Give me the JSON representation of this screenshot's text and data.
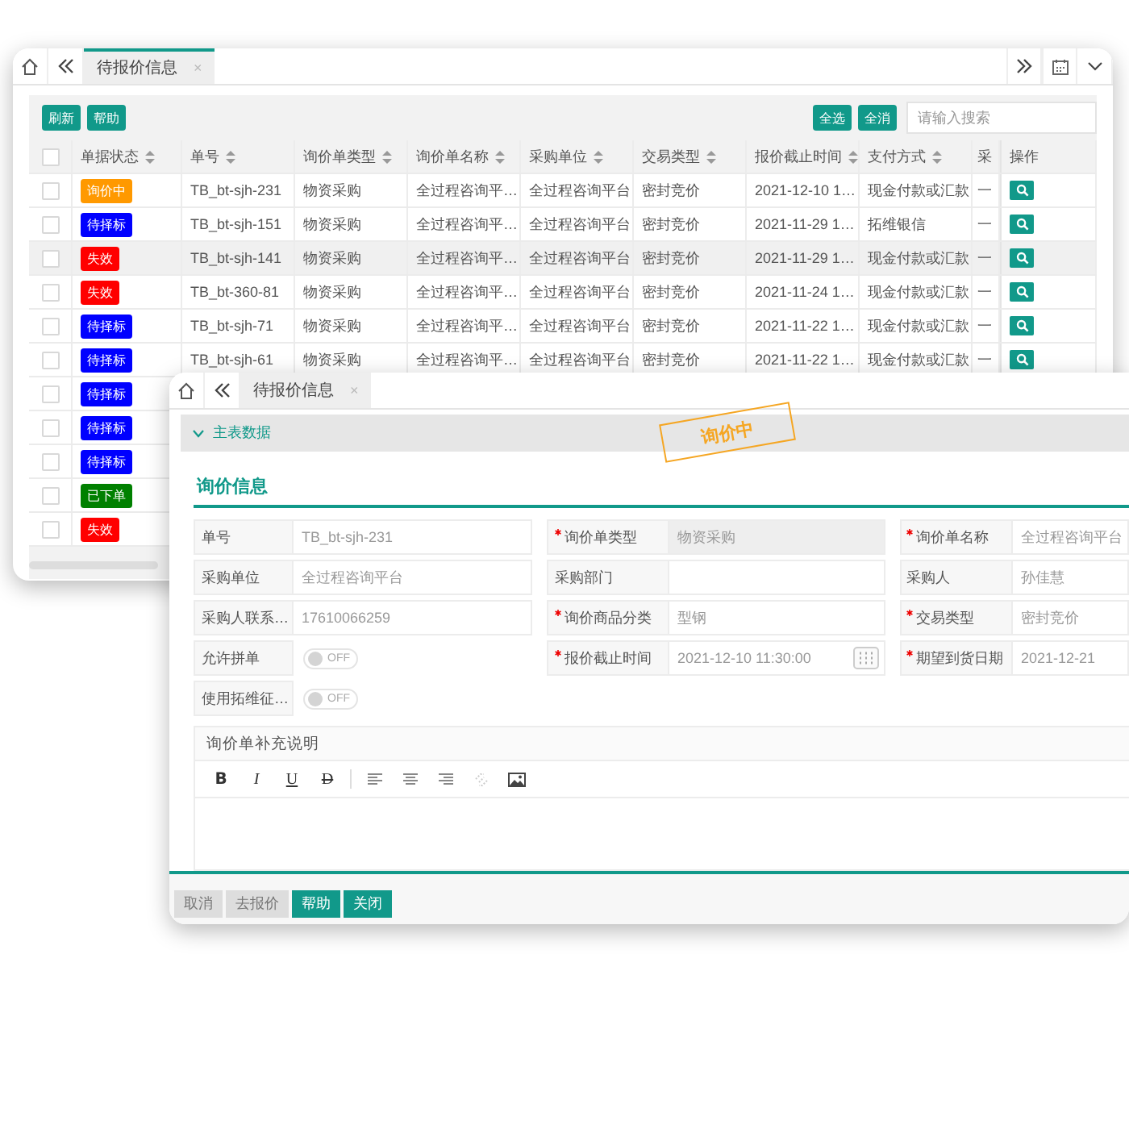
{
  "back_window": {
    "tab": {
      "label": "待报价信息",
      "close": "×",
      "selected": true
    },
    "toolbar": {
      "left_buttons": [
        "刷新",
        "帮助"
      ],
      "right_buttons": [
        "全选",
        "全消"
      ],
      "search": {
        "placeholder": "请输入搜索"
      }
    },
    "table": {
      "header_checked": false,
      "columns": [
        "单据状态",
        "单号",
        "询价单类型",
        "询价单名称",
        "采购单位",
        "交易类型",
        "报价截止时间",
        "支付方式",
        "采",
        "操作"
      ],
      "rows": [
        {
          "checked": false,
          "selected": false,
          "status": {
            "text": "询价中",
            "color": "#ff9900"
          },
          "cells": [
            "TB_bt-sjh-231",
            "物资采购",
            "全过程咨询平…",
            "全过程咨询平台",
            "密封竞价",
            "2021-12-10 1…",
            "现金付款或汇款",
            "一"
          ]
        },
        {
          "checked": false,
          "selected": false,
          "status": {
            "text": "待择标",
            "color": "#0000ff"
          },
          "cells": [
            "TB_bt-sjh-151",
            "物资采购",
            "全过程咨询平…",
            "全过程咨询平台",
            "密封竞价",
            "2021-11-29 1…",
            "拓维银信",
            "一"
          ]
        },
        {
          "checked": false,
          "selected": true,
          "status": {
            "text": "失效",
            "color": "#ff0000"
          },
          "cells": [
            "TB_bt-sjh-141",
            "物资采购",
            "全过程咨询平…",
            "全过程咨询平台",
            "密封竞价",
            "2021-11-29 1…",
            "现金付款或汇款",
            "一"
          ]
        },
        {
          "checked": false,
          "selected": false,
          "status": {
            "text": "失效",
            "color": "#ff0000"
          },
          "cells": [
            "TB_bt-360-81",
            "物资采购",
            "全过程咨询平…",
            "全过程咨询平台",
            "密封竞价",
            "2021-11-24 1…",
            "现金付款或汇款",
            "一"
          ]
        },
        {
          "checked": false,
          "selected": false,
          "status": {
            "text": "待择标",
            "color": "#0000ff"
          },
          "cells": [
            "TB_bt-sjh-71",
            "物资采购",
            "全过程咨询平…",
            "全过程咨询平台",
            "密封竞价",
            "2021-11-22 1…",
            "现金付款或汇款",
            "一"
          ]
        },
        {
          "checked": false,
          "selected": false,
          "status": {
            "text": "待择标",
            "color": "#0000ff"
          },
          "cells": [
            "TB_bt-sjh-61",
            "物资采购",
            "全过程咨询平…",
            "全过程咨询平台",
            "密封竞价",
            "2021-11-22 1…",
            "现金付款或汇款",
            "一"
          ]
        },
        {
          "checked": false,
          "selected": false,
          "status": {
            "text": "待择标",
            "color": "#0000ff"
          }
        },
        {
          "checked": false,
          "selected": false,
          "status": {
            "text": "待择标",
            "color": "#0000ff"
          }
        },
        {
          "checked": false,
          "selected": false,
          "status": {
            "text": "待择标",
            "color": "#0000ff"
          }
        },
        {
          "checked": false,
          "selected": false,
          "status": {
            "text": "已下单",
            "color": "#008000"
          }
        },
        {
          "checked": false,
          "selected": false,
          "status": {
            "text": "失效",
            "color": "#ff0000"
          }
        }
      ]
    }
  },
  "front_window": {
    "tab": {
      "label": "待报价信息",
      "close": "×",
      "selected": true
    },
    "section": {
      "label": "主表数据",
      "expanded": true
    },
    "stamp": "询价中",
    "title": "询价信息",
    "fields": [
      {
        "kind": "text",
        "label": "单号",
        "value": "TB_bt-sjh-231",
        "required": false,
        "disabled": false
      },
      {
        "kind": "text",
        "label": "询价单类型",
        "value": "物资采购",
        "required": true,
        "disabled": true
      },
      {
        "kind": "text",
        "label": "询价单名称",
        "value": "全过程咨询平台",
        "required": true,
        "disabled": false
      },
      {
        "kind": "text",
        "label": "采购单位",
        "value": "全过程咨询平台",
        "required": false,
        "disabled": false
      },
      {
        "kind": "text",
        "label": "采购部门",
        "required": false,
        "disabled": false
      },
      {
        "kind": "text",
        "label": "采购人",
        "value": "孙佳慧",
        "required": false,
        "disabled": false
      },
      {
        "kind": "text",
        "label": "采购人联系…",
        "value": "17610066259",
        "required": false,
        "disabled": false
      },
      {
        "kind": "text",
        "label": "询价商品分类",
        "value": "型钢",
        "required": true,
        "disabled": false
      },
      {
        "kind": "text",
        "label": "交易类型",
        "value": "密封竞价",
        "required": true,
        "disabled": false
      },
      {
        "kind": "toggle",
        "label": "允许拼单",
        "on": false,
        "state_text": "OFF",
        "required": false
      },
      {
        "kind": "date",
        "label": "报价截止时间",
        "value": "2021-12-10 11:30:00",
        "required": true,
        "disabled": false
      },
      {
        "kind": "text",
        "label": "期望到货日期",
        "value": "2021-12-21",
        "required": true,
        "disabled": false
      },
      {
        "kind": "toggle",
        "label": "使用拓维征…",
        "on": false,
        "state_text": "OFF",
        "required": false
      }
    ],
    "editor": {
      "label": "询价单补充说明",
      "tools": [
        {
          "kind": "bold",
          "glyph": "B"
        },
        {
          "kind": "italic",
          "glyph": "I"
        },
        {
          "kind": "underline",
          "glyph": "U"
        },
        {
          "kind": "strike",
          "glyph": "D"
        },
        {
          "kind": "separator"
        },
        {
          "kind": "align-left"
        },
        {
          "kind": "align-center"
        },
        {
          "kind": "align-right"
        },
        {
          "kind": "link"
        },
        {
          "kind": "image"
        }
      ]
    },
    "footer_buttons": [
      {
        "label": "取消",
        "kind": "secondary"
      },
      {
        "label": "去报价",
        "kind": "secondary"
      },
      {
        "label": "帮助",
        "kind": "primary"
      },
      {
        "label": "关闭",
        "kind": "primary"
      }
    ]
  }
}
